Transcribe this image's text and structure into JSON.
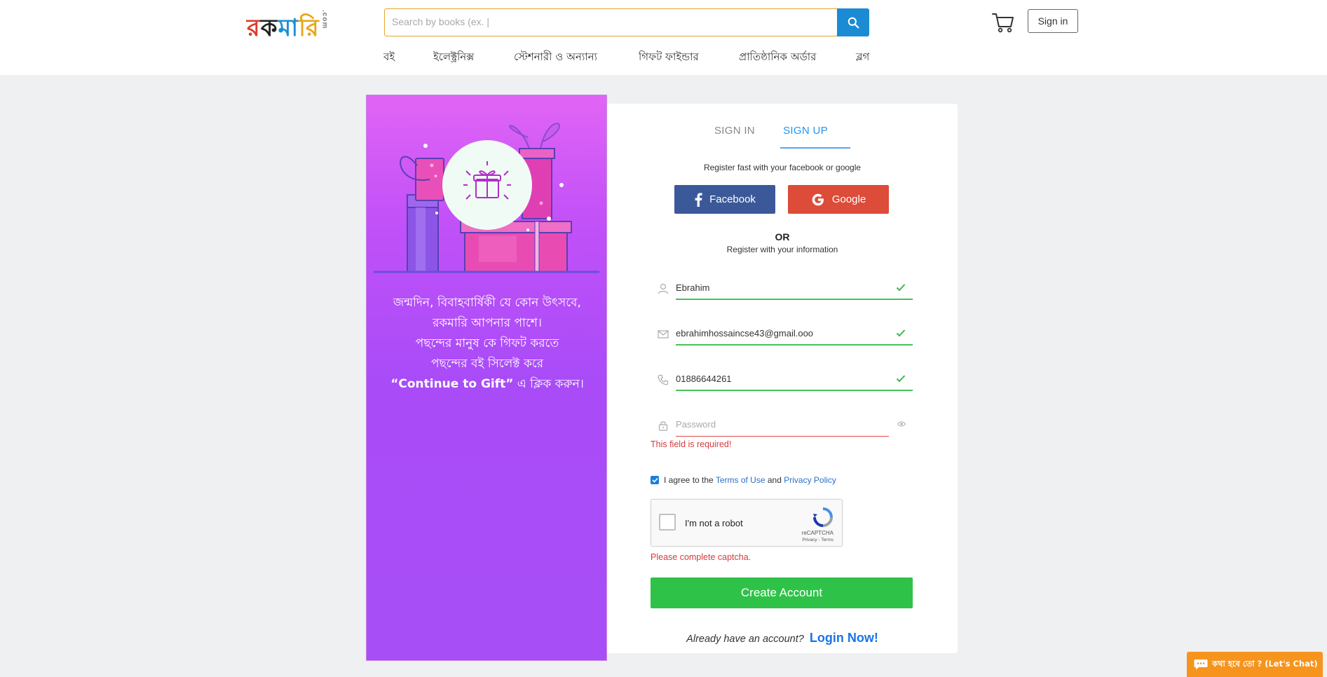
{
  "header": {
    "logo_letters": [
      "র",
      "ক",
      "মা",
      "রি"
    ],
    "logo_suffix": ".com",
    "search_placeholder": "Search by books (ex. |",
    "signin_label": "Sign in"
  },
  "nav": {
    "items": [
      "বই",
      "ইলেক্ট্রনিক্স",
      "স্টেশনারী ও অন্যান্য",
      "গিফট ফাইন্ডার",
      "প্রাতিষ্ঠানিক অর্ডার",
      "ব্লগ"
    ]
  },
  "promo": {
    "line1": "জন্মদিন, বিবাহবার্ষিকী যে কোন উৎসবে,",
    "line2": "রকমারি আপনার পাশে।",
    "line3": "পছন্দের মানুষ কে গিফট করতে",
    "line4": "পছন্দের বই সিলেক্ট করে",
    "line5_bold": "“Continue to Gift”",
    "line5_rest": " এ ক্লিক করুন।"
  },
  "auth": {
    "tab_signin": "SIGN IN",
    "tab_signup": "SIGN UP",
    "register_fast": "Register fast with your facebook or google",
    "facebook_label": "Facebook",
    "google_label": "Google",
    "or_label": "OR",
    "register_info": "Register with your information",
    "name_value": "Ebrahim",
    "email_value": "ebrahimhossaincse43@gmail.ooo",
    "phone_value": "01886644261",
    "password_placeholder": "Password",
    "password_error": "This field is required!",
    "agree_prefix": "I agree to the ",
    "terms_label": "Terms of Use",
    "agree_and": " and ",
    "privacy_label": "Privacy Policy",
    "captcha_label": "I'm not a robot",
    "captcha_brand": "reCAPTCHA",
    "captcha_links": "Privacy - Terms",
    "captcha_error": "Please complete captcha.",
    "create_label": "Create Account",
    "already_text": "Already have an account?",
    "login_now": "Login Now!"
  },
  "chat": {
    "label": "কথা হবে তো ? (Let's Chat)"
  },
  "colors": {
    "accent_blue": "#1b8bd3",
    "facebook": "#3b5998",
    "google": "#dd4b39",
    "success": "#2fc249",
    "error": "#d43c3c",
    "chat": "#f7941d"
  }
}
